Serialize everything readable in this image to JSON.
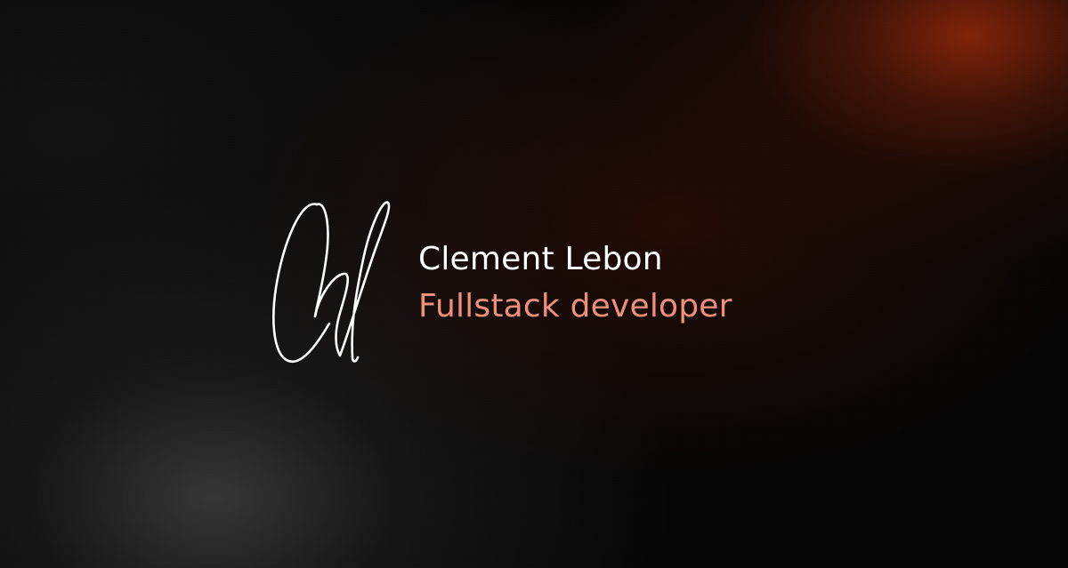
{
  "profile": {
    "name": "Clement Lebon",
    "role": "Fullstack developer"
  },
  "colors": {
    "name_text": "#ffffff",
    "role_text": "#f0907a",
    "accent_glow": "#8a2a0a"
  },
  "icons": {
    "signature": "handwritten-signature-monogram"
  }
}
